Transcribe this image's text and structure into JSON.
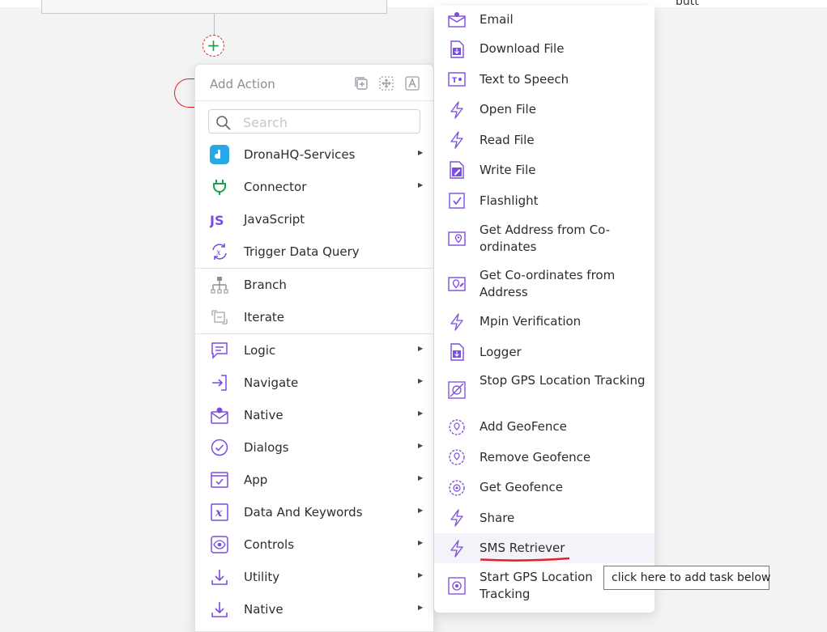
{
  "canvas": {
    "partial_text": "butt"
  },
  "add_node": {
    "symbol": "+"
  },
  "panel": {
    "title": "Add Action",
    "header_icons": [
      "copy-icon",
      "move-icon",
      "translate-icon"
    ],
    "search": {
      "placeholder": "Search",
      "value": ""
    },
    "groups": [
      [
        {
          "label": "DronaHQ-Services",
          "icon": "dronahq-logo-icon",
          "submenu": true
        },
        {
          "label": "Connector",
          "icon": "plug-icon",
          "submenu": true
        },
        {
          "label": "JavaScript",
          "icon": "js-icon",
          "submenu": false
        },
        {
          "label": "Trigger Data Query",
          "icon": "refresh-variable-icon",
          "submenu": false
        }
      ],
      [
        {
          "label": "Branch",
          "icon": "branch-icon",
          "submenu": false
        },
        {
          "label": "Iterate",
          "icon": "iterate-icon",
          "submenu": false
        }
      ],
      [
        {
          "label": "Logic",
          "icon": "comment-icon",
          "submenu": true
        },
        {
          "label": "Navigate",
          "icon": "navigate-icon",
          "submenu": true
        },
        {
          "label": "Native",
          "icon": "mail-user-icon",
          "submenu": true
        },
        {
          "label": "Dialogs",
          "icon": "check-circle-icon",
          "submenu": true
        },
        {
          "label": "App",
          "icon": "app-window-icon",
          "submenu": true
        },
        {
          "label": "Data And Keywords",
          "icon": "variable-icon",
          "submenu": true
        },
        {
          "label": "Controls",
          "icon": "eye-icon",
          "submenu": true
        },
        {
          "label": "Utility",
          "icon": "download-icon",
          "submenu": true
        },
        {
          "label": "Native",
          "icon": "download-icon",
          "submenu": true
        }
      ]
    ]
  },
  "submenu": {
    "items": [
      {
        "label": "Email",
        "icon": "mail-icon"
      },
      {
        "label": "Download File",
        "icon": "file-download-icon"
      },
      {
        "label": "Text to Speech",
        "icon": "text-speech-icon"
      },
      {
        "label": "Open File",
        "icon": "bolt-icon"
      },
      {
        "label": "Read File",
        "icon": "bolt-icon"
      },
      {
        "label": "Write File",
        "icon": "file-edit-icon"
      },
      {
        "label": "Flashlight",
        "icon": "flashlight-icon"
      },
      {
        "label": "Get Address from Co-ordinates",
        "icon": "map-pin-icon"
      },
      {
        "label": "Get Co-ordinates from Address",
        "icon": "map-edit-icon"
      },
      {
        "label": "Mpin Verification",
        "icon": "bolt-icon"
      },
      {
        "label": "Logger",
        "icon": "file-download-icon"
      },
      {
        "label": "Stop GPS Location Tracking",
        "icon": "gps-off-icon"
      },
      {
        "label": "Add GeoFence",
        "icon": "geofence-icon"
      },
      {
        "label": "Remove Geofence",
        "icon": "geofence-icon"
      },
      {
        "label": "Get Geofence",
        "icon": "geofence-icon"
      },
      {
        "label": "Share",
        "icon": "bolt-icon"
      },
      {
        "label": "SMS Retriever",
        "icon": "bolt-icon",
        "highlighted": true
      },
      {
        "label": "Start GPS Location Tracking",
        "icon": "gps-icon"
      }
    ]
  },
  "tooltip": {
    "text": "click here to add task below"
  },
  "colors": {
    "accent": "#7b4ce0",
    "add_green": "#19a34a",
    "annotation_red": "#e0202a",
    "highlight_row": "#f3f3f9"
  }
}
